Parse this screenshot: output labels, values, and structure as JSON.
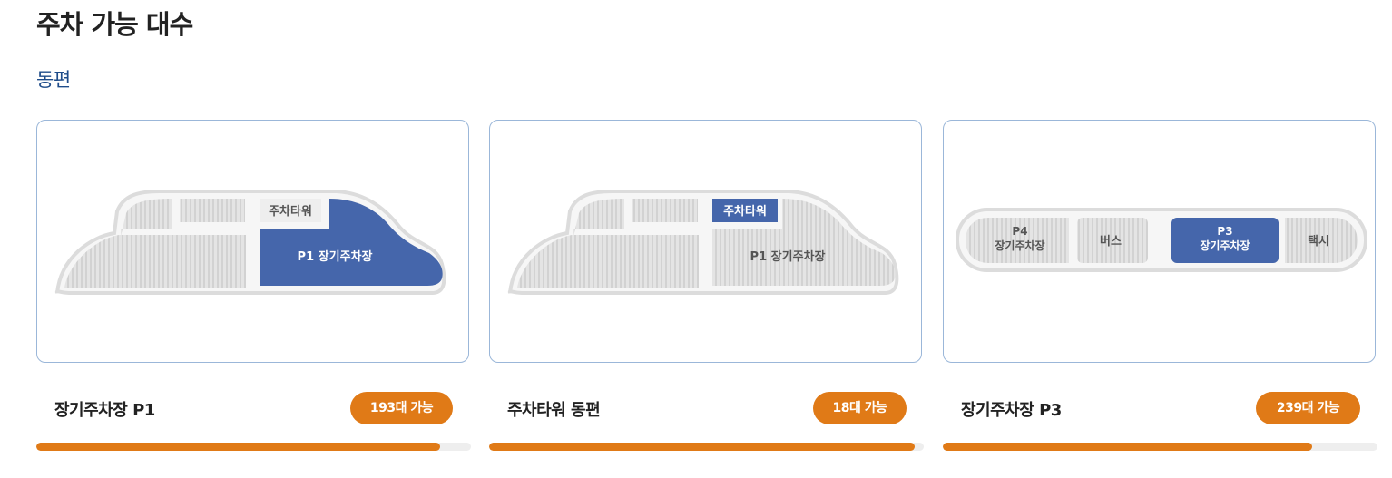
{
  "page": {
    "title": "주차 가능 대수",
    "section": "동편"
  },
  "colors": {
    "accent": "#e07a17",
    "highlight": "#4566ab",
    "lot": "#e2e2e2",
    "outline": "#dcdcdc",
    "border": "#9bb7d9"
  },
  "cards": [
    {
      "name": "장기주차장 P1",
      "badge": "193대 가능",
      "progress_percent": 93,
      "map": {
        "tower_label": "주차타워",
        "main_label": "P1 장기주차장"
      }
    },
    {
      "name": "주차타워 동편",
      "badge": "18대 가능",
      "progress_percent": 98,
      "map": {
        "tower_label": "주차타워",
        "main_label": "P1 장기주차장"
      }
    },
    {
      "name": "장기주차장 P3",
      "badge": "239대 가능",
      "progress_percent": 85,
      "map": {
        "p4_line1": "P4",
        "p4_line2": "장기주차장",
        "bus_label": "버스",
        "p3_line1": "P3",
        "p3_line2": "장기주차장",
        "taxi_label": "택시"
      }
    }
  ]
}
